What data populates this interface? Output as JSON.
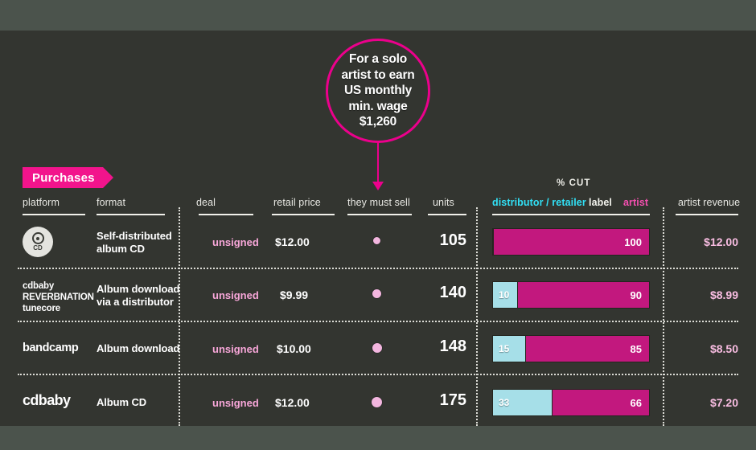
{
  "callout": {
    "text": "For a solo\nartist to earn\nUS monthly\nmin. wage\n$1,260"
  },
  "section": {
    "tag": "Purchases"
  },
  "columns": {
    "platform": "platform",
    "format": "format",
    "deal": "deal",
    "retail_price": "retail price",
    "they_must_sell": "they must sell",
    "units": "units",
    "pct_cut": "% CUT",
    "legend_distributor": "distributor / retailer",
    "legend_label": "label",
    "legend_artist": "artist",
    "artist_revenue": "artist revenue"
  },
  "colors": {
    "accent_pink": "#ec008c",
    "tag_pink": "#f2148c",
    "cyan": "#31e0f5",
    "bar_cyan": "#a6dfe8",
    "bar_magenta": "#c2187e",
    "panel_bg": "#333530",
    "page_bg": "#4b534c"
  },
  "rows": [
    {
      "platform_icon": "cd-disc-icon",
      "platform_cd_label": "CD",
      "platform_names": [],
      "format": "Self-distributed\nalbum CD",
      "deal": "unsigned",
      "retail_price": "$12.00",
      "must_sell_dot": 9,
      "units": "105",
      "cut_distributor": 0,
      "cut_artist": 100,
      "artist_revenue": "$12.00"
    },
    {
      "platform_icon": "",
      "platform_cd_label": "",
      "platform_names": [
        "cdbaby",
        "REVERBNATION",
        "tunecore"
      ],
      "format": "Album download\nvia a distributor",
      "deal": "unsigned",
      "retail_price": "$9.99",
      "must_sell_dot": 10,
      "units": "140",
      "cut_distributor": 10,
      "cut_artist": 90,
      "artist_revenue": "$8.99"
    },
    {
      "platform_icon": "",
      "platform_cd_label": "",
      "platform_names": [
        "bandcamp"
      ],
      "format": "Album download",
      "deal": "unsigned",
      "retail_price": "$10.00",
      "must_sell_dot": 11,
      "units": "148",
      "cut_distributor": 15,
      "cut_artist": 85,
      "artist_revenue": "$8.50"
    },
    {
      "platform_icon": "",
      "platform_cd_label": "",
      "platform_names": [
        "cdbaby"
      ],
      "format": "Album CD",
      "deal": "unsigned",
      "retail_price": "$12.00",
      "must_sell_dot": 12,
      "units": "175",
      "cut_distributor": 33,
      "cut_artist": 66,
      "artist_revenue": "$7.20"
    }
  ],
  "chart_data": {
    "type": "bar",
    "title": "% CUT",
    "orientation": "horizontal",
    "stacked": true,
    "categories": [
      "Self-distributed album CD",
      "Album download via a distributor",
      "Album download (bandcamp)",
      "Album CD (cdbaby)"
    ],
    "series": [
      {
        "name": "distributor / retailer",
        "color": "#a6dfe8",
        "values": [
          0,
          10,
          15,
          33
        ]
      },
      {
        "name": "artist",
        "color": "#c2187e",
        "values": [
          100,
          90,
          85,
          66
        ]
      }
    ],
    "xlabel": "% CUT",
    "ylabel": "",
    "xlim": [
      0,
      100
    ],
    "grid": false,
    "legend_position": "top"
  }
}
